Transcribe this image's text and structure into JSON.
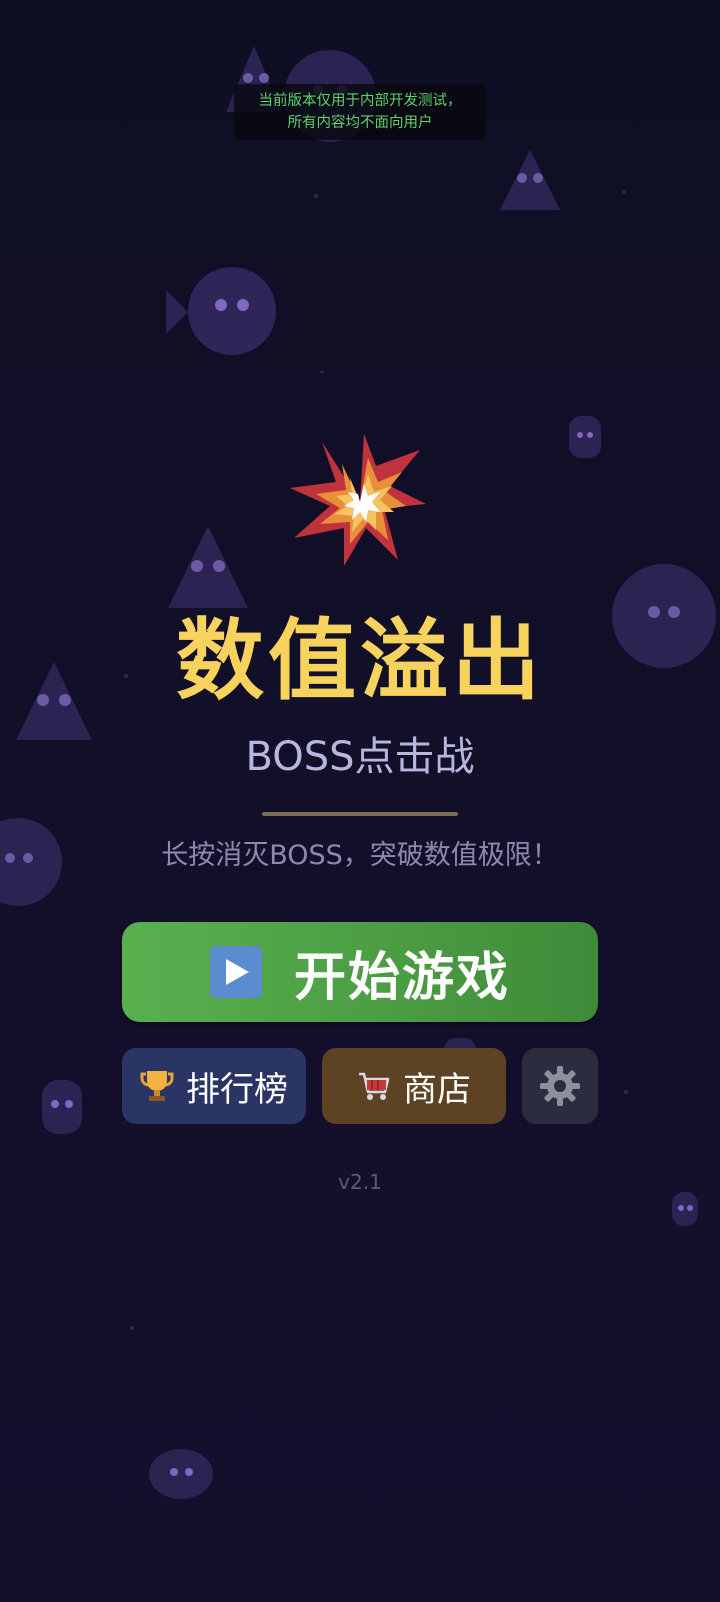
{
  "notice": {
    "line1": "当前版本仅用于内部开发测试，",
    "line2": "所有内容均不面向用户"
  },
  "title": "数值溢出",
  "subtitle": "BOSS点击战",
  "tagline": "长按消灭BOSS，突破数值极限！",
  "buttons": {
    "start_label": "开始游戏",
    "rank_label": "排行榜",
    "shop_label": "商店"
  },
  "icons": {
    "play": "play-icon",
    "trophy": "trophy-icon",
    "cart": "shopping-cart-icon",
    "settings": "gear-icon",
    "explosion": "explosion-icon"
  },
  "version": "v2.1",
  "colors": {
    "title": "#f7d25c",
    "start_button": "#58b04f",
    "rank_button": "#2a3566",
    "shop_button": "#5e4224",
    "settings_button": "#2b2d3e"
  }
}
